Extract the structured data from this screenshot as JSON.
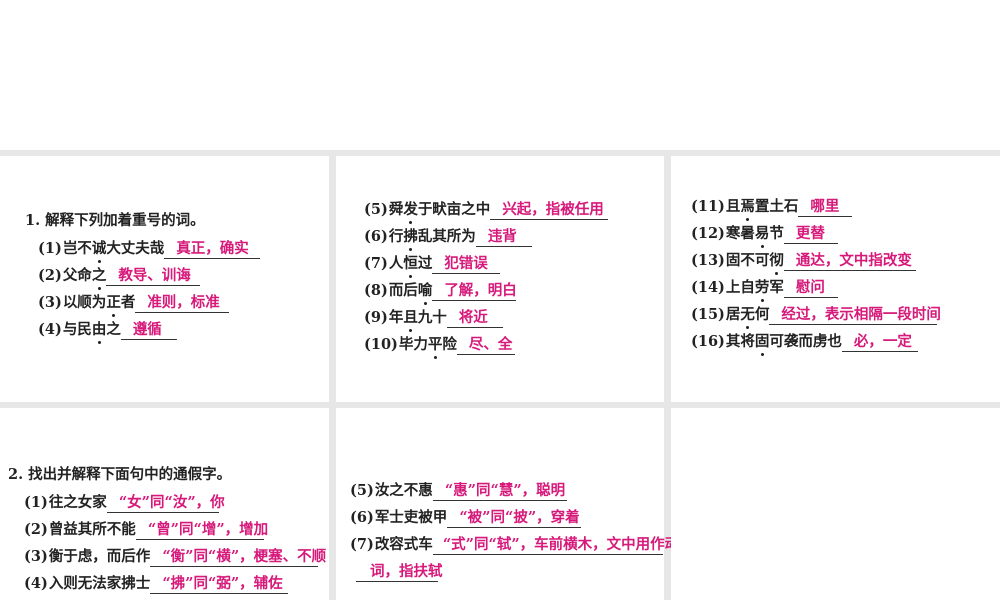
{
  "q1": {
    "title": "1. 解释下列加着重号的词。",
    "items": [
      {
        "num": "(1)",
        "pre": "岂不",
        "dot": "诚",
        "post": "大丈夫哉",
        "answer": "真正，确实"
      },
      {
        "num": "(2)",
        "pre": "父命",
        "dot": "之",
        "post": "",
        "answer": "教导、训诲"
      },
      {
        "num": "(3)",
        "pre": "以顺为",
        "dot": "正",
        "post": "者",
        "answer": "准则，标准"
      },
      {
        "num": "(4)",
        "pre": "与民",
        "dot": "由",
        "post": "之",
        "answer": "遵循"
      },
      {
        "num": "(5)",
        "pre": "舜",
        "dot": "发",
        "post": "于畎亩之中",
        "answer": "兴起，指被任用"
      },
      {
        "num": "(6)",
        "pre": "行",
        "dot": "拂",
        "post": "乱其所为",
        "answer": "违背"
      },
      {
        "num": "(7)",
        "pre": "人",
        "dot": "恒",
        "post": "过",
        "answer": "犯错误"
      },
      {
        "num": "(8)",
        "pre": "而后",
        "dot": "喻",
        "post": "",
        "answer": "了解，明白"
      },
      {
        "num": "(9)",
        "pre": "年",
        "dot": "且",
        "post": "九十",
        "answer": "将近"
      },
      {
        "num": "(10)",
        "pre": "毕力",
        "dot": "平",
        "post": "险",
        "answer": "尽、全"
      },
      {
        "num": "(11)",
        "pre": "且",
        "dot": "焉",
        "post": "置土石",
        "answer": "哪里"
      },
      {
        "num": "(12)",
        "pre": "寒暑",
        "dot": "易",
        "post": "节",
        "answer": "更替"
      },
      {
        "num": "(13)",
        "pre": "固不可",
        "dot": "彻",
        "post": "",
        "answer": "通达，文中指改变"
      },
      {
        "num": "(14)",
        "pre": "上自",
        "dot": "劳",
        "post": "军",
        "answer": "慰问"
      },
      {
        "num": "(15)",
        "pre": "居",
        "dot": "无",
        "post": "何",
        "answer": "经过，表示相隔一段时间"
      },
      {
        "num": "(16)",
        "pre": "其将",
        "dot": "固",
        "post": "可袭而虏也",
        "answer": "必，一定"
      }
    ]
  },
  "q2": {
    "title": "2. 找出并解释下面句中的通假字。",
    "items": [
      {
        "num": "(1)",
        "text": "往之女家",
        "answer": "“女”同“汝”，你"
      },
      {
        "num": "(2)",
        "text": "曾益其所不能",
        "answer": "“曾”同“增”，增加"
      },
      {
        "num": "(3)",
        "text": "衡于虑，而后作",
        "answer": "“衡”同“横”，梗塞、不顺"
      },
      {
        "num": "(4)",
        "text": "入则无法家拂士",
        "answer": "“拂”同“弼”，辅佐"
      },
      {
        "num": "(5)",
        "text": "汝之不惠",
        "answer": "“惠”同“慧”，聪明"
      },
      {
        "num": "(6)",
        "text": "军士吏被甲",
        "answer": "“被”同“披”，穿着"
      },
      {
        "num": "(7)",
        "text": "改容式车",
        "answer": "“式”同“轼”，车前横木，文中用作动",
        "answer2": "词，指扶轼"
      }
    ]
  }
}
